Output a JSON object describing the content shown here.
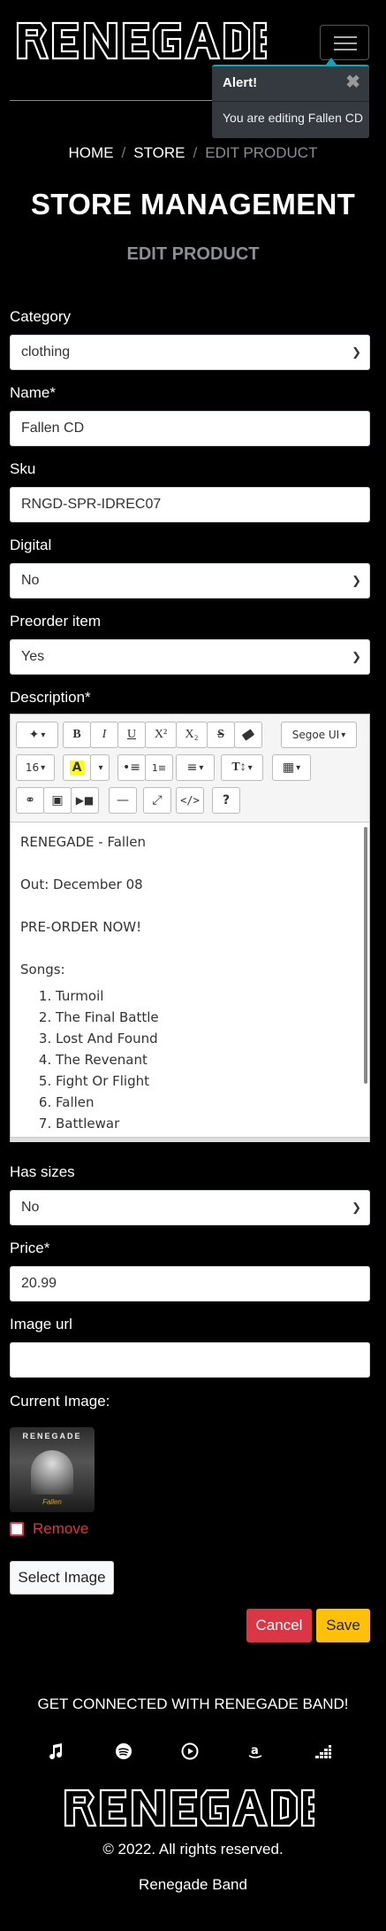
{
  "header": {
    "brand": "RENEGADE"
  },
  "alert": {
    "title": "Alert!",
    "close": "✖",
    "message": "You are editing Fallen CD"
  },
  "breadcrumb": {
    "home": "HOME",
    "store": "STORE",
    "current": "EDIT PRODUCT",
    "separator": "/"
  },
  "page": {
    "title": "STORE MANAGEMENT",
    "subtitle": "EDIT PRODUCT"
  },
  "form": {
    "category": {
      "label": "Category",
      "value": "clothing"
    },
    "name": {
      "label": "Name*",
      "value": "Fallen CD"
    },
    "sku": {
      "label": "Sku",
      "value": "RNGD-SPR-IDREC07"
    },
    "digital": {
      "label": "Digital",
      "value": "No"
    },
    "preorder": {
      "label": "Preorder item",
      "value": "Yes"
    },
    "description": {
      "label": "Description*"
    },
    "has_sizes": {
      "label": "Has sizes",
      "value": "No"
    },
    "price": {
      "label": "Price*",
      "value": "20.99"
    },
    "image_url": {
      "label": "Image url",
      "value": ""
    },
    "current_image": {
      "label": "Current Image:"
    },
    "remove": {
      "label": "Remove"
    }
  },
  "editor": {
    "toolbar": {
      "font_name": "Segoe UI",
      "font_size": "16",
      "superscript": "X²",
      "subscript": "X₂"
    },
    "content": {
      "line1": "RENEGADE - Fallen",
      "line2": "Out: December 08",
      "line3": "PRE-ORDER NOW!",
      "songs_heading": "Songs:",
      "songs": [
        "Turmoil",
        "The Final Battle",
        "Lost And Found",
        "The Revenant",
        "Fight Or Flight",
        "Fallen",
        "Battlewar"
      ]
    }
  },
  "thumbnail": {
    "band": "RENEGADE",
    "album": "Fallen"
  },
  "buttons": {
    "select_image": "Select Image",
    "cancel": "Cancel",
    "save": "Save"
  },
  "footer": {
    "connect": "GET CONNECTED WITH RENEGADE BAND!",
    "social_icons": [
      "music-note-icon",
      "spotify-icon",
      "youtube-music-icon",
      "amazon-icon",
      "deezer-icon"
    ],
    "brand": "RENEGADE",
    "copyright": "© 2022. All rights reserved.",
    "band_name": "Renegade Band"
  },
  "colors": {
    "background": "#000000",
    "danger": "#dc3545",
    "warning": "#ffc107",
    "muted": "#8a8f96",
    "alert_bg": "#343a40",
    "alert_accent": "#17a2b8"
  }
}
